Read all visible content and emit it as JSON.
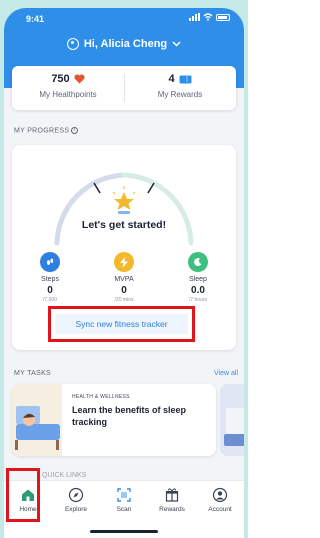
{
  "status_bar": {
    "time": "9:41"
  },
  "header": {
    "greeting": "Hi, Alicia Cheng"
  },
  "stats": {
    "healthpoints_value": "750",
    "healthpoints_label": "My Healthpoints",
    "rewards_value": "4",
    "rewards_label": "My Rewards"
  },
  "progress": {
    "section_title": "MY PROGRESS",
    "headline": "Let's get started!",
    "metrics": [
      {
        "label": "Steps",
        "value": "0",
        "sub": "/7,000",
        "icon": "steps-icon",
        "color": "#2f7fe0"
      },
      {
        "label": "MVPA",
        "value": "0",
        "sub": "/20 mins",
        "icon": "mvpa-bolt-icon",
        "color": "#f4b82b"
      },
      {
        "label": "Sleep",
        "value": "0.0",
        "sub": "/7 hours",
        "icon": "sleep-moon-icon",
        "color": "#3fbf7f"
      }
    ],
    "sync_label": "Sync new fitness tracker"
  },
  "tasks": {
    "section_title": "MY TASKS",
    "view_all": "View all",
    "items": [
      {
        "category": "HEALTH & WELLNESS",
        "title": "Learn the benefits of sleep tracking"
      }
    ]
  },
  "quick_links": {
    "title": "QUICK LINKS"
  },
  "tab_bar": {
    "tabs": [
      {
        "label": "Home",
        "icon": "home-icon"
      },
      {
        "label": "Explore",
        "icon": "compass-icon"
      },
      {
        "label": "Scan",
        "icon": "scan-icon"
      },
      {
        "label": "Rewards",
        "icon": "gift-icon"
      },
      {
        "label": "Account",
        "icon": "account-icon"
      }
    ]
  },
  "colors": {
    "accent": "#2f8fe8",
    "background": "#c4e9e6",
    "highlight": "#e0141b",
    "heart": "#e4572e"
  }
}
